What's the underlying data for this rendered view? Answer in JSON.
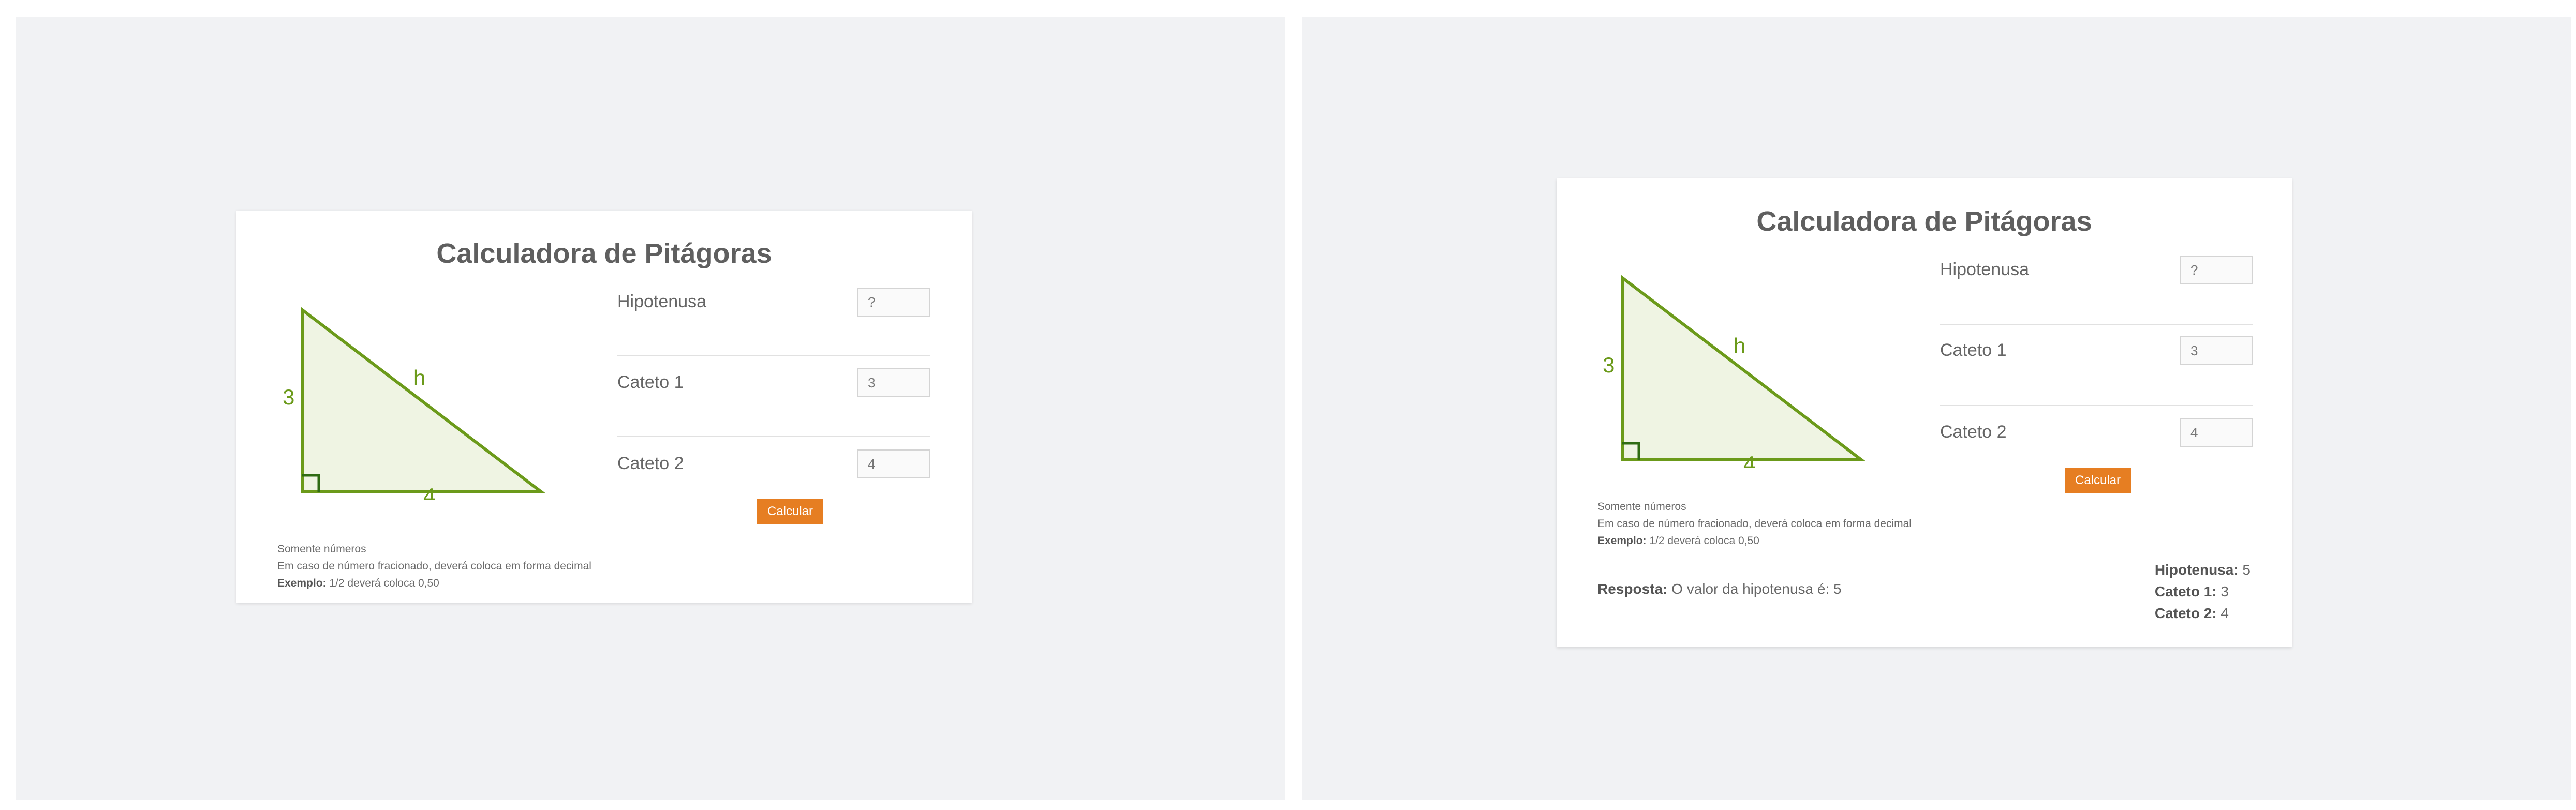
{
  "calculator": {
    "title": "Calculadora de Pitágoras",
    "triangle": {
      "side_a": "3",
      "side_b": "4",
      "hypotenuse": "h"
    },
    "labels": {
      "hipotenusa": "Hipotenusa",
      "cateto1": "Cateto 1",
      "cateto2": "Cateto 2"
    },
    "button_label": "Calcular",
    "notes": {
      "line1": "Somente números",
      "line2": "Em caso de número fracionado, deverá coloca em forma decimal",
      "example_label": "Exemplo:",
      "example_text": " 1/2 deverá coloca 0,50"
    }
  },
  "left": {
    "inputs": {
      "hipotenusa": "",
      "cateto1": "3",
      "cateto2": "4"
    },
    "placeholders": {
      "hipotenusa": "?",
      "cateto1": "",
      "cateto2": ""
    }
  },
  "right": {
    "inputs": {
      "hipotenusa": "",
      "cateto1": "3",
      "cateto2": "4"
    },
    "placeholders": {
      "hipotenusa": "?",
      "cateto1": "",
      "cateto2": ""
    },
    "answer": {
      "label": "Resposta:",
      "text": " O valor da hipotenusa é: 5"
    },
    "results": {
      "hipotenusa_label": "Hipotenusa:",
      "hipotenusa_value": " 5",
      "cateto1_label": "Cateto 1:",
      "cateto1_value": " 3",
      "cateto2_label": "Cateto 2:",
      "cateto2_value": " 4"
    }
  },
  "colors": {
    "triangle_stroke": "#6b9a1a",
    "triangle_fill": "#eff4e3",
    "right_angle": "#2f6b14",
    "button": "#e67e22"
  }
}
